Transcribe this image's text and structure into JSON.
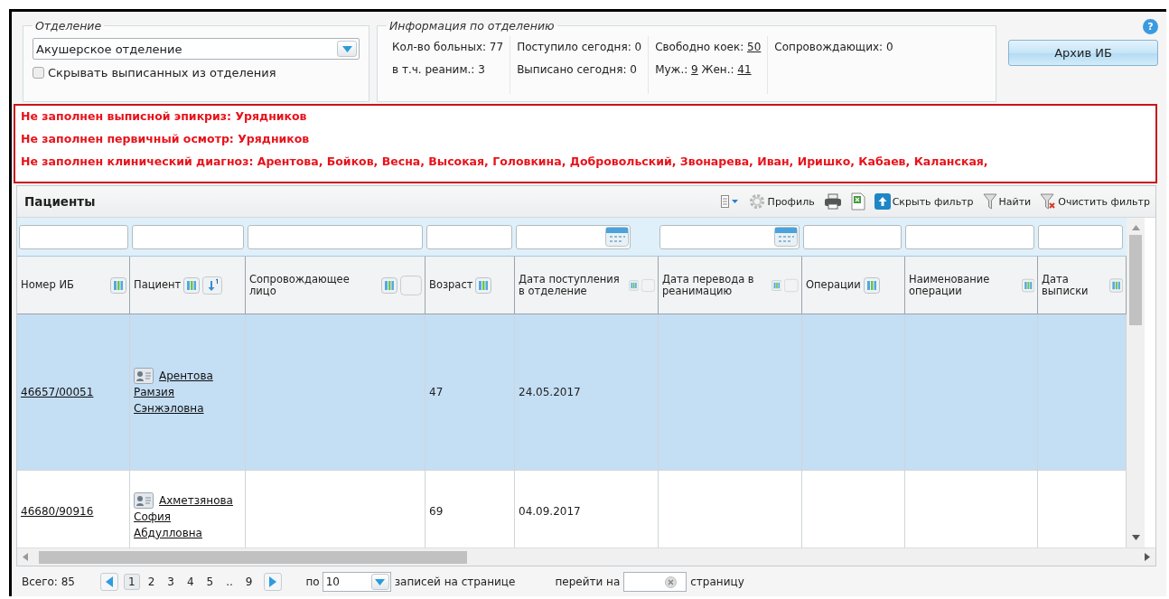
{
  "department": {
    "legend": "Отделение",
    "select_value": "Акушерское отделение",
    "hide_discharged": {
      "label": "Скрывать выписанных из отделения",
      "checked": false
    }
  },
  "info": {
    "legend": "Информация по отделению",
    "columns": [
      [
        [
          {
            "text": "Кол-во больных: 77",
            "link": false
          }
        ],
        [
          {
            "text": "в т.ч. реаним.: 3",
            "link": false
          }
        ]
      ],
      [
        [
          {
            "text": "Поступило сегодня: 0",
            "link": false
          }
        ],
        [
          {
            "text": "Выписано сегодня: 0",
            "link": false
          }
        ]
      ],
      [
        [
          {
            "text": "Свободно коек: ",
            "link": false
          },
          {
            "text": "50",
            "link": true
          }
        ],
        [
          {
            "text": "Муж.: ",
            "link": false
          },
          {
            "text": "9",
            "link": true
          },
          {
            "text": " Жен.: ",
            "link": false
          },
          {
            "text": "41",
            "link": true
          }
        ]
      ],
      [
        [
          {
            "text": "Сопровождающих: 0",
            "link": false
          }
        ]
      ]
    ]
  },
  "help": "?",
  "archive_button": "Архив ИБ",
  "warnings": [
    "Не заполнен выписной эпикриз: Урядников",
    "Не заполнен первичный осмотр: Урядников",
    "Не заполнен клинический диагноз: Арентова, Бойков, Весна, Высокая, Головкина, Добровольский, Звонарева, Иван, Иришко, Кабаев, Каланская,"
  ],
  "patients": {
    "title": "Пациенты",
    "toolbar": [
      {
        "kind": "columns"
      },
      {
        "kind": "gear",
        "label": "Профиль"
      },
      {
        "kind": "print"
      },
      {
        "kind": "excel"
      },
      {
        "kind": "hide",
        "label": "Скрыть фильтр"
      },
      {
        "kind": "find",
        "label": "Найти"
      },
      {
        "kind": "clear",
        "label": "Очистить фильтр"
      }
    ],
    "columns": [
      {
        "label": "Номер ИБ",
        "kind": "text",
        "sort": false,
        "extra": false
      },
      {
        "label": "Пациент",
        "kind": "text",
        "sort": true,
        "extra": false
      },
      {
        "label": "Сопровождающее лицо",
        "kind": "text",
        "sort": false,
        "extra": true
      },
      {
        "label": "Возраст",
        "kind": "text",
        "sort": false,
        "extra": false
      },
      {
        "label": "Дата поступления в отделение",
        "kind": "date",
        "sort": false,
        "extra": true
      },
      {
        "label": "Дата перевода в реанимацию",
        "kind": "date",
        "sort": false,
        "extra": true
      },
      {
        "label": "Операции",
        "kind": "text",
        "sort": false,
        "extra": false
      },
      {
        "label": "Наименование операции",
        "kind": "text",
        "sort": false,
        "extra": false
      },
      {
        "label": "Дата выписки",
        "kind": "text",
        "sort": false,
        "extra": false
      }
    ],
    "rows": [
      {
        "selected": true,
        "cells": [
          "46657/00051",
          "Арентова Рамзия Сэнжэловна",
          "",
          "47",
          "24.05.2017",
          "",
          "",
          "",
          ""
        ]
      },
      {
        "selected": false,
        "cells": [
          "46680/90916",
          "Ахметзянова София Абдулловна",
          "",
          "69",
          "04.09.2017",
          "",
          "",
          "",
          ""
        ]
      }
    ]
  },
  "pager": {
    "total": "Всего: 85",
    "pages": [
      {
        "label": "1",
        "selected": true
      },
      {
        "label": "2",
        "selected": false
      },
      {
        "label": "3",
        "selected": false
      },
      {
        "label": "4",
        "selected": false
      },
      {
        "label": "5",
        "selected": false
      },
      {
        "label": "..",
        "selected": false
      },
      {
        "label": "9",
        "selected": false
      }
    ],
    "per_label": "по",
    "per_value": "10",
    "per_suffix": "записей на странице",
    "goto_label": "перейти на",
    "goto_suffix": "страницу"
  }
}
